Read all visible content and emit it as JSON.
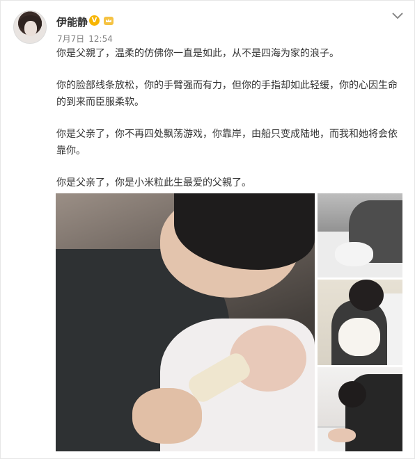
{
  "post": {
    "author": {
      "name": "伊能静",
      "verified_badge": "V",
      "badge_color": "#f7b500",
      "avatar_icon": "avatar"
    },
    "date": "7月7日",
    "time": "12:54",
    "paragraphs": [
      "你是父親了，温柔的仿佛你一直是如此，从不是四海为家的浪子。",
      "你的脸部线条放松，你的手臂强而有力，但你的手指却如此轻缓，你的心因生命的到来而臣服柔软。",
      "你是父亲了，你不再四处飘荡游戏，你靠岸，由船只变成陆地，而我和她将会依靠你。",
      "你是父亲了，你是小米粒此生最爱的父親了。"
    ],
    "photos": [
      {
        "id": "photo-main",
        "subject": "father feeding baby with bottle"
      },
      {
        "id": "photo-right-1",
        "subject": "black and white father with baby"
      },
      {
        "id": "photo-right-2",
        "subject": "father holding baby in bed"
      },
      {
        "id": "photo-right-3",
        "subject": "father at baby crib"
      }
    ],
    "menu_icon": "chevron-down-icon"
  },
  "colors": {
    "text": "#333333",
    "meta": "#808080",
    "border": "#e6e6e6"
  }
}
